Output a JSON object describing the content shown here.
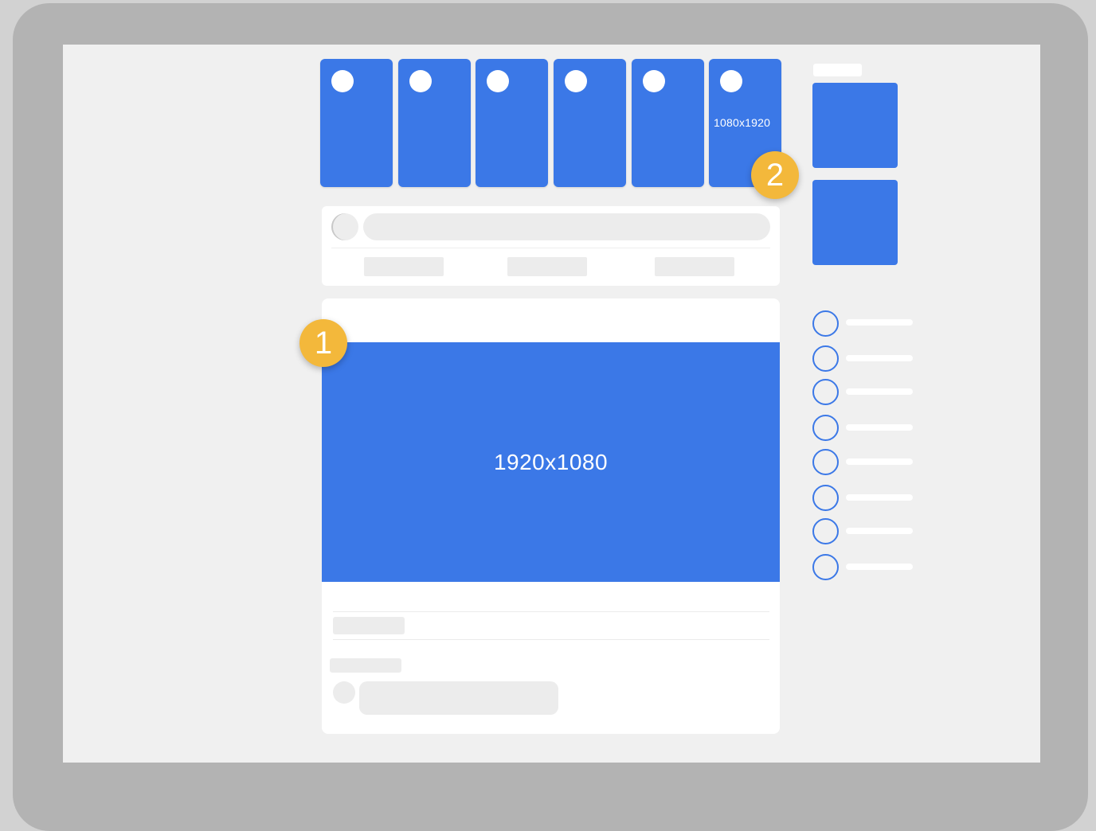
{
  "colors": {
    "accent": "#3b78e7",
    "badge": "#f3b83b",
    "frame": "#b3b3b3",
    "screen": "#f0f0f0",
    "card": "#ffffff",
    "skeleton": "#ececec"
  },
  "stories": {
    "items": [
      {
        "size_label": ""
      },
      {
        "size_label": ""
      },
      {
        "size_label": ""
      },
      {
        "size_label": ""
      },
      {
        "size_label": ""
      },
      {
        "size_label": "1080x1920"
      }
    ]
  },
  "post": {
    "image_label": "1920x1080"
  },
  "badges": {
    "one": "1",
    "two": "2"
  }
}
